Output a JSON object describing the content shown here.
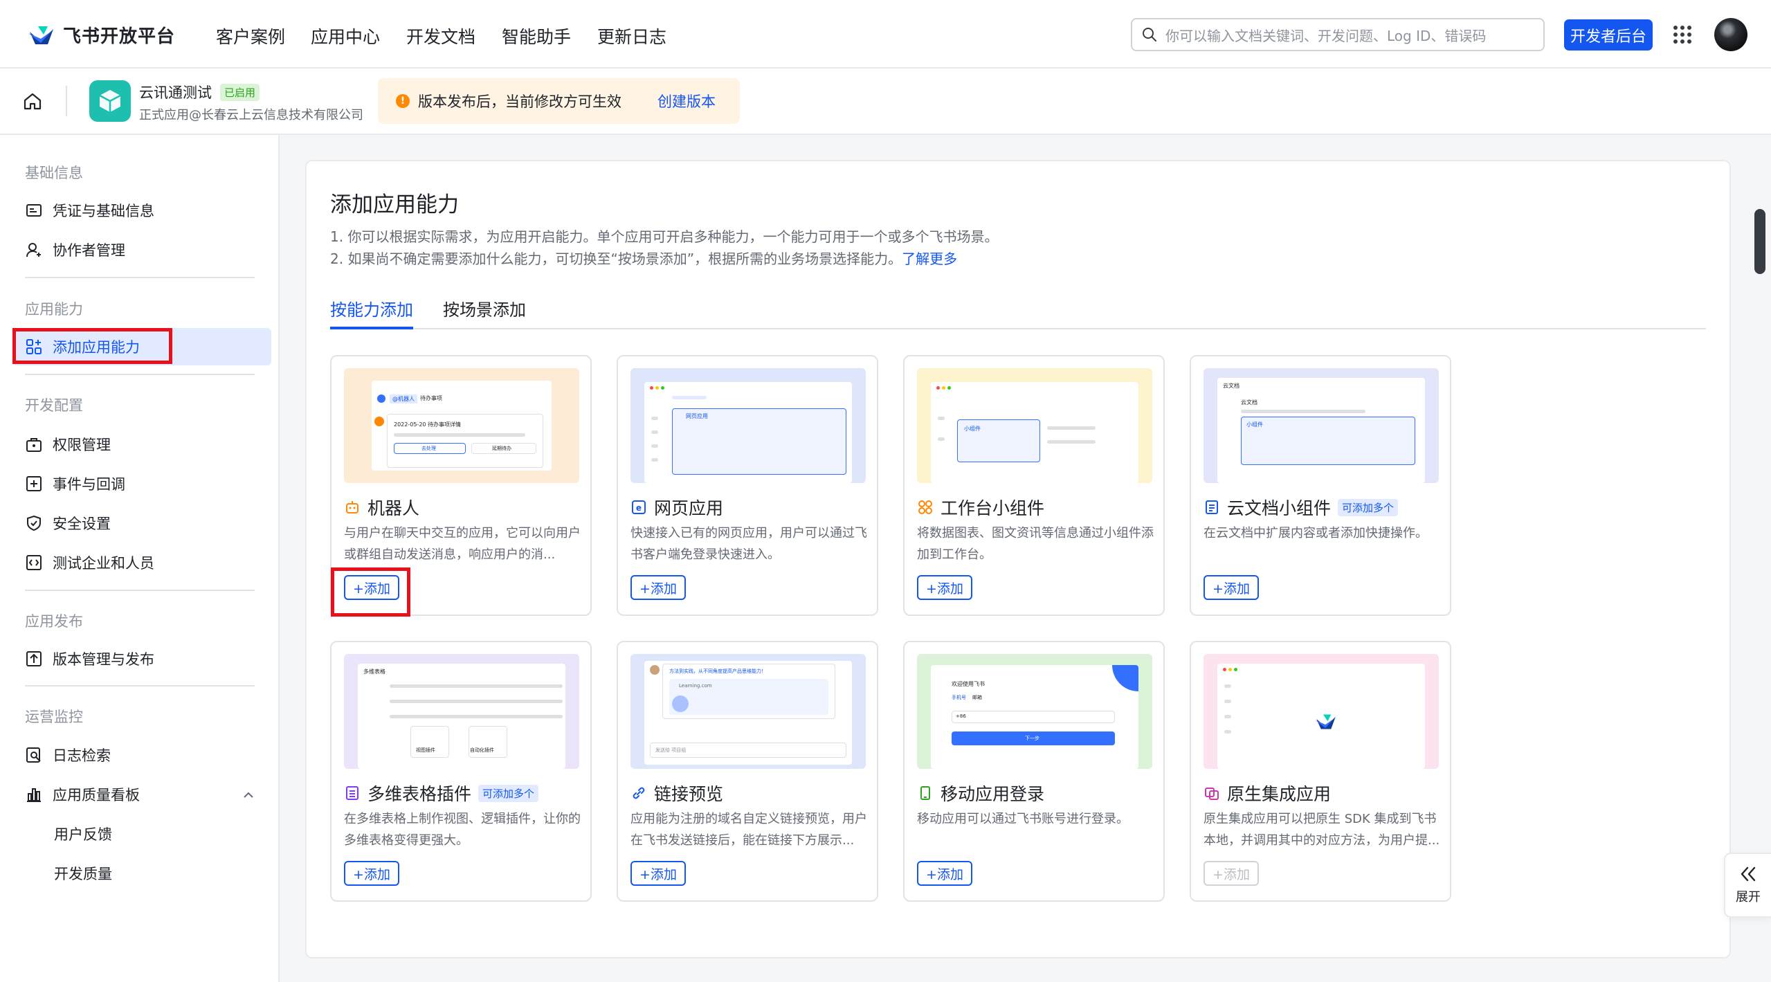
{
  "brand": {
    "name": "飞书开放平台"
  },
  "nav": {
    "items": [
      "客户案例",
      "应用中心",
      "开发文档",
      "智能助手",
      "更新日志"
    ]
  },
  "search": {
    "placeholder": "你可以输入文档关键词、开发问题、Log ID、错误码"
  },
  "header": {
    "dev_console_label": "开发者后台"
  },
  "app": {
    "name": "云讯通测试",
    "status": "已启用",
    "company": "正式应用@长春云上云信息技术有限公司",
    "notice": "版本发布后，当前修改方可生效",
    "notice_link": "创建版本"
  },
  "sidebar": {
    "groups": [
      {
        "label": "基础信息",
        "items": [
          "凭证与基础信息",
          "协作者管理"
        ]
      },
      {
        "label": "应用能力",
        "items": [
          "添加应用能力"
        ]
      },
      {
        "label": "开发配置",
        "items": [
          "权限管理",
          "事件与回调",
          "安全设置",
          "测试企业和人员"
        ]
      },
      {
        "label": "应用发布",
        "items": [
          "版本管理与发布"
        ]
      },
      {
        "label": "运营监控",
        "items": [
          "日志检索",
          "应用质量看板"
        ],
        "subitems": [
          "用户反馈",
          "开发质量"
        ]
      }
    ],
    "active": "添加应用能力"
  },
  "main": {
    "title": "添加应用能力",
    "desc1": "1. 你可以根据实际需求，为应用开启能力。单个应用可开启多种能力，一个能力可用于一个或多个飞书场景。",
    "desc2": "2. 如果尚不确定需要添加什么能力，可切换至“按场景添加”，根据所需的业务场景选择能力。",
    "desc2_link": "了解更多",
    "tabs": [
      "按能力添加",
      "按场景添加"
    ],
    "add_label": "+添加",
    "cards": [
      {
        "title": "机器人",
        "desc": "与用户在聊天中交互的应用，它可以向用户或群组自动发送消息，响应用户的消...",
        "badge": ""
      },
      {
        "title": "网页应用",
        "desc": "快速接入已有的网页应用，用户可以通过飞书客户端免登录快速进入。",
        "badge": ""
      },
      {
        "title": "工作台小组件",
        "desc": "将数据图表、图文资讯等信息通过小组件添加到工作台。",
        "badge": ""
      },
      {
        "title": "云文档小组件",
        "desc": "在云文档中扩展内容或者添加快捷操作。",
        "badge": "可添加多个"
      },
      {
        "title": "多维表格插件",
        "desc": "在多维表格上制作视图、逻辑插件，让你的多维表格变得更强大。",
        "badge": "可添加多个"
      },
      {
        "title": "链接预览",
        "desc": "应用能为注册的域名自定义链接预览，用户在飞书发送链接后，能在链接下方展示...",
        "badge": ""
      },
      {
        "title": "移动应用登录",
        "desc": "移动应用可以通过飞书账号进行登录。",
        "badge": ""
      },
      {
        "title": "原生集成应用",
        "desc": "原生集成应用可以把原生 SDK 集成到飞书本地，并调用其中的对应方法，为用户提...",
        "badge": ""
      }
    ],
    "previews": {
      "bot_chip": "@机器人",
      "bot_chip2": "待办事项",
      "bot_line": "2022-05-20 待办事项详情",
      "bot_btn1": "去处理",
      "bot_btn2": "延期待办",
      "web_tab": "网页应用",
      "widget_label": "小组件",
      "doc_title": "云文档",
      "doc_sub": "云文档",
      "doc_widget": "小组件",
      "base_title": "多维表格",
      "base_view": "视图插件",
      "base_auto": "自动化插件",
      "link_msg": "方法到实践，从不同角度提高产品思维能力！",
      "link_url": "Learning.com",
      "link_input": "发送给 项目组",
      "mobile_title": "欢迎使用飞书",
      "mobile_tab1": "手机号",
      "mobile_tab2": "邮箱",
      "mobile_code": "+86",
      "mobile_next": "下一步"
    }
  },
  "expand": {
    "label": "展开"
  },
  "colors": {
    "primary": "#1456f0",
    "highlight": "#e8101a"
  }
}
